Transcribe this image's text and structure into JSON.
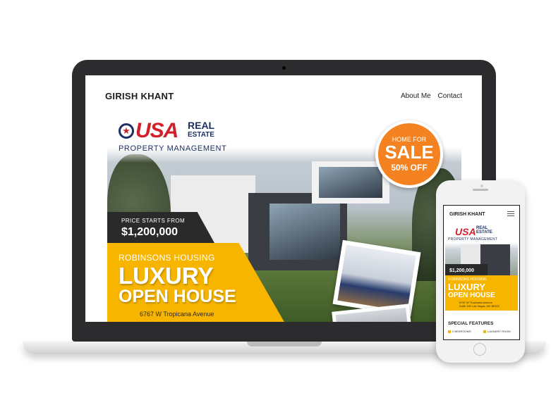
{
  "laptop": {
    "site_title": "GIRISH KHANT",
    "nav": [
      "About Me",
      "Contact"
    ],
    "banner": {
      "logo_usa": "USA",
      "logo_real": "REAL",
      "logo_estate": "ESTATE",
      "logo_subtitle": "PROPERTY MANAGEMENT",
      "sale_small": "HOME FOR",
      "sale_big": "SALE",
      "sale_discount": "50% OFF",
      "price_label": "PRICE STARTS FROM",
      "price_value": "$1,200,000",
      "subtitle": "ROBINSONS HOUSING",
      "headline_1": "LUXURY",
      "headline_2": "OPEN HOUSE",
      "address": "6767 W Tropicana Avenue"
    }
  },
  "phone": {
    "site_title": "GIRISH KHANT",
    "banner": {
      "logo_usa": "USA",
      "logo_real": "REAL",
      "logo_estate": "ESTATE",
      "logo_subtitle": "PROPERTY MANAGEMENT",
      "price_value": "$1,200,000",
      "subtitle": "ROBINSONS HOUSING",
      "headline_1": "LUXURY",
      "headline_2": "OPEN HOUSE",
      "address_1": "6767 W Tropicana Avenue",
      "address_2": "Suite 100 Las Vegas, NV 89103"
    },
    "special_features": "SPECIAL FEATURES",
    "features": [
      "2 BEDROOMS",
      "LAUNDRY ROOM"
    ]
  },
  "colors": {
    "accent_yellow": "#f7b500",
    "sale_orange": "#f58220",
    "logo_red": "#d21f2a",
    "logo_navy": "#1d2f63",
    "device_dark": "#2c2c2e"
  }
}
